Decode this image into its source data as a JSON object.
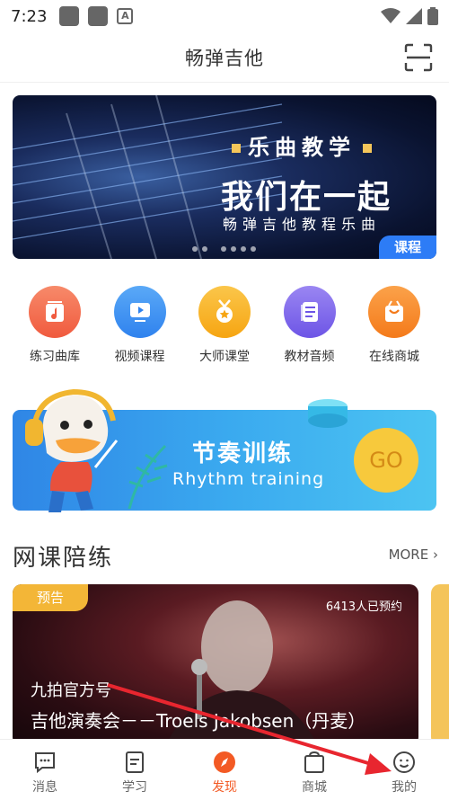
{
  "status_bar": {
    "time": "7:23",
    "icons": [
      "gallery-icon",
      "gallery-icon",
      "a-icon",
      "wifi-icon",
      "signal-icon",
      "battery-icon"
    ],
    "a_glyph": "A"
  },
  "header": {
    "title": "畅弹吉他",
    "scan_icon": "scan-icon"
  },
  "banner": {
    "sub_title": "乐曲教学",
    "main_title": "我们在一起",
    "description": "畅弹吉他教程乐曲",
    "tag": "课程",
    "page_count": 6,
    "active_page": 1
  },
  "categories": [
    {
      "label": "练习曲库",
      "icon": "music-library-icon",
      "color": "#f46a4d"
    },
    {
      "label": "视频课程",
      "icon": "video-course-icon",
      "color": "#3d95f3"
    },
    {
      "label": "大师课堂",
      "icon": "medal-icon",
      "color": "#f8ad1c"
    },
    {
      "label": "教材音频",
      "icon": "document-icon",
      "color": "#7d67ec"
    },
    {
      "label": "在线商城",
      "icon": "shopping-bag-icon",
      "color": "#f58526"
    }
  ],
  "rhythm": {
    "title": "节奏训练",
    "subtitle": "Rhythm training",
    "go_label": "GO"
  },
  "section": {
    "title": "网课陪练",
    "more": "MORE"
  },
  "live_card": {
    "tag": "预告",
    "count": "6413人已预约",
    "author": "九拍官方号",
    "title": "吉他演奏会－－Troels Jakobsen（丹麦）"
  },
  "bottom_nav": {
    "items": [
      {
        "label": "消息",
        "icon": "message-icon",
        "active": false
      },
      {
        "label": "学习",
        "icon": "study-icon",
        "active": false
      },
      {
        "label": "发现",
        "icon": "discover-icon",
        "active": true
      },
      {
        "label": "商城",
        "icon": "shop-icon",
        "active": false
      },
      {
        "label": "我的",
        "icon": "profile-icon",
        "active": false
      }
    ]
  },
  "colors": {
    "accent": "#f35a24",
    "blue": "#2d7cf6",
    "arrow": "#e8262f"
  }
}
